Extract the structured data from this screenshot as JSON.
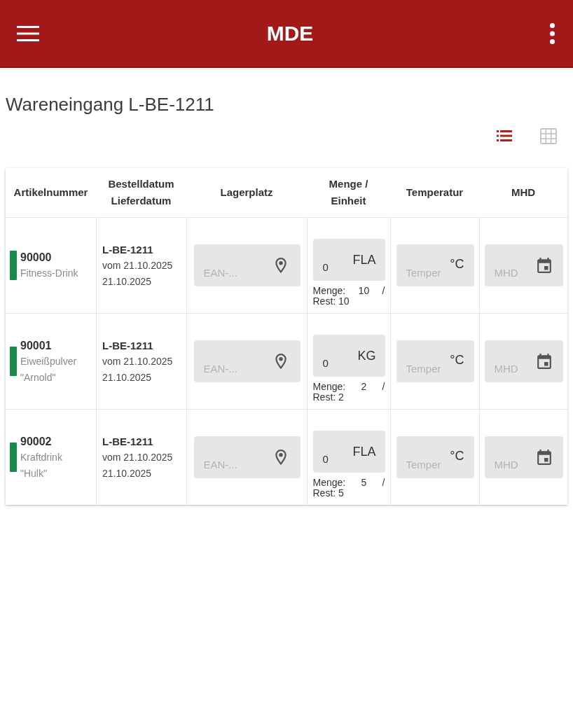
{
  "app_bar": {
    "title": "MDE"
  },
  "page": {
    "title": "Wareneingang L-BE-1211"
  },
  "view_toggle": [
    {
      "kind": "list",
      "selected": true
    },
    {
      "kind": "grid",
      "selected": false
    }
  ],
  "table": {
    "columns": [
      [
        "Artikelnummer"
      ],
      [
        "Bestelldatum",
        "Lieferdatum"
      ],
      [
        "Lagerplatz"
      ],
      [
        "Menge /",
        "Einheit"
      ],
      [
        "Temperatur"
      ],
      [
        "MHD"
      ]
    ],
    "rows": [
      {
        "color": "#1a8a4a",
        "article_number": "90000",
        "name": "Fitness-Drink",
        "order": "L-BE-1211",
        "order_date": "vom 21.10.2025",
        "delivery_date": "21.10.2025",
        "location": {
          "placeholder": "EAN-..."
        },
        "quantity": {
          "value": "0",
          "unit": "FLA",
          "label": "Menge:",
          "amount": "10",
          "separator": "/",
          "rest": "Rest: 10"
        },
        "temperature": {
          "placeholder": "Temper",
          "unit": "°C"
        },
        "mhd": {
          "placeholder": "MHD"
        }
      },
      {
        "color": "#1a8a4a",
        "article_number": "90001",
        "name": "Eiweißpulver \"Arnold\"",
        "order": "L-BE-1211",
        "order_date": "vom 21.10.2025",
        "delivery_date": "21.10.2025",
        "location": {
          "placeholder": "EAN-..."
        },
        "quantity": {
          "value": "0",
          "unit": "KG",
          "label": "Menge:",
          "amount": "2",
          "separator": "/",
          "rest": "Rest: 2"
        },
        "temperature": {
          "placeholder": "Temper",
          "unit": "°C"
        },
        "mhd": {
          "placeholder": "MHD"
        }
      },
      {
        "color": "#1a8a4a",
        "article_number": "90002",
        "name": "Kraftdrink \"Hulk\"",
        "order": "L-BE-1211",
        "order_date": "vom 21.10.2025",
        "delivery_date": "21.10.2025",
        "location": {
          "placeholder": "EAN-..."
        },
        "quantity": {
          "value": "0",
          "unit": "FLA",
          "label": "Menge:",
          "amount": "5",
          "separator": "/",
          "rest": "Rest: 5"
        },
        "temperature": {
          "placeholder": "Temper",
          "unit": "°C"
        },
        "mhd": {
          "placeholder": "MHD"
        }
      }
    ]
  }
}
